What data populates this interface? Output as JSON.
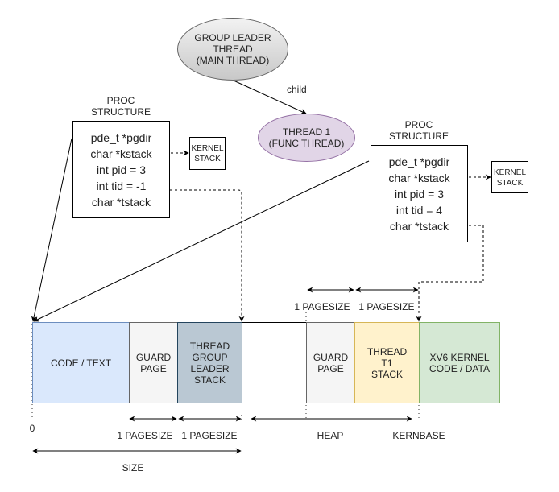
{
  "threads": {
    "leader": {
      "lines": [
        "GROUP LEADER",
        "THREAD",
        "(MAIN THREAD)"
      ],
      "fill": "#e0e0e0"
    },
    "child": {
      "lines": [
        "THREAD 1",
        "(FUNC THREAD)"
      ],
      "fill": "#e1d5e7"
    },
    "edge_label": "child"
  },
  "proc_left": {
    "title": [
      "PROC",
      "STRUCTURE"
    ],
    "fields": [
      "pde_t *pgdir",
      "char *kstack",
      "int pid = 3",
      "int tid = -1",
      "char *tstack"
    ],
    "kernel_stack": [
      "KERNEL",
      "STACK"
    ]
  },
  "proc_right": {
    "title": [
      "PROC",
      "STRUCTURE"
    ],
    "fields": [
      "pde_t *pgdir",
      "char *kstack",
      "int pid = 3",
      "int tid = 4",
      "char *tstack"
    ],
    "kernel_stack": [
      "KERNEL",
      "STACK"
    ]
  },
  "memory": {
    "segments": [
      {
        "id": "code",
        "lines": [
          "CODE / TEXT"
        ],
        "fill": "#dae8fc",
        "stroke": "#6c8ebf"
      },
      {
        "id": "guard1",
        "lines": [
          "GUARD",
          "PAGE"
        ],
        "fill": "#f5f5f5",
        "stroke": "#666666"
      },
      {
        "id": "leader-stack",
        "lines": [
          "THREAD",
          "GROUP",
          "LEADER",
          "STACK"
        ],
        "fill": "#bac8d3",
        "stroke": "#23445d"
      },
      {
        "id": "heap",
        "lines": [
          ""
        ],
        "fill": "#ffffff",
        "stroke": "#000000"
      },
      {
        "id": "guard2",
        "lines": [
          "GUARD",
          "PAGE"
        ],
        "fill": "#f5f5f5",
        "stroke": "#666666"
      },
      {
        "id": "t1-stack",
        "lines": [
          "THREAD",
          "T1",
          "STACK"
        ],
        "fill": "#fff2cc",
        "stroke": "#d6b656"
      },
      {
        "id": "kernel",
        "lines": [
          "XV6 KERNEL",
          "CODE / DATA"
        ],
        "fill": "#d5e8d4",
        "stroke": "#82b366"
      }
    ],
    "labels": {
      "zero": "0",
      "pagesize_guard1": "1 PAGESIZE",
      "pagesize_leader": "1 PAGESIZE",
      "pagesize_guard2": "1 PAGESIZE",
      "pagesize_t1": "1 PAGESIZE",
      "heap": "HEAP",
      "kernbase": "KERNBASE",
      "size": "SIZE"
    }
  }
}
